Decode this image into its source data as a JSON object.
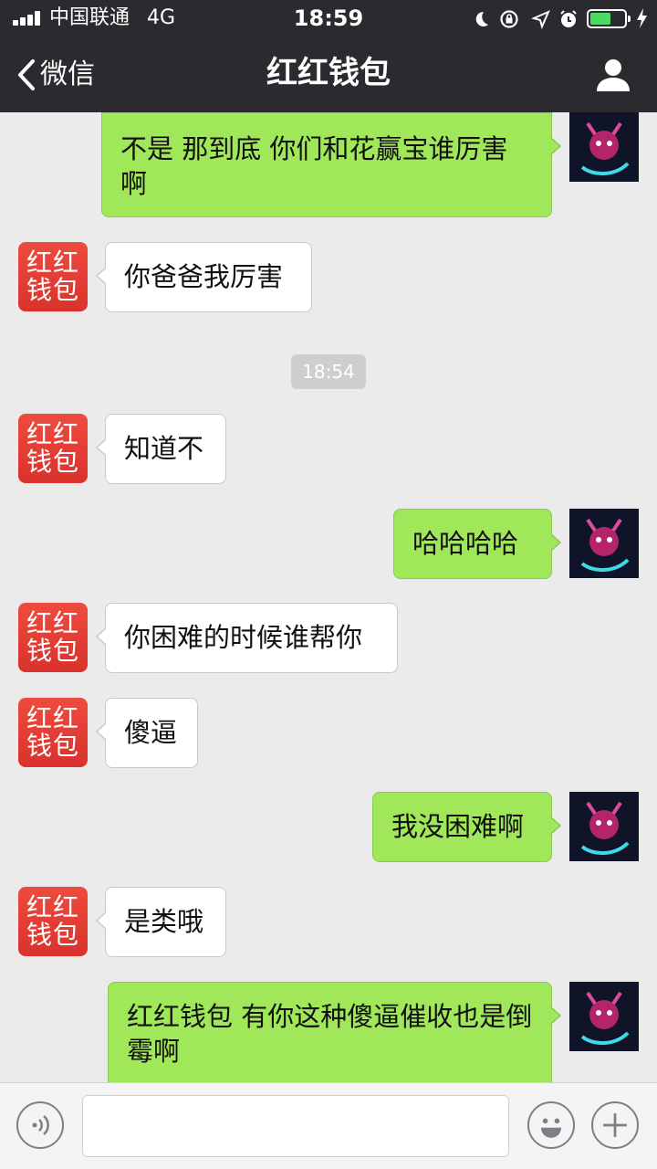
{
  "status_bar": {
    "carrier": "中国联通",
    "network": "4G",
    "time": "18:59",
    "icons": [
      "signal-icon",
      "moon-icon",
      "rotation-lock-icon",
      "location-arrow-icon",
      "alarm-icon",
      "battery-icon",
      "charging-bolt-icon"
    ],
    "battery_color": "#4cd964"
  },
  "nav": {
    "back_label": "微信",
    "title": "红红钱包",
    "right_icon": "person-icon"
  },
  "contact_avatar_text": "红红钱包",
  "colors": {
    "header_bg": "#2b2b2f",
    "chat_bg": "#ebebeb",
    "outgoing_bubble": "#a0e75a",
    "incoming_bubble": "#ffffff",
    "avatar_red": "#e1392f"
  },
  "messages": [
    {
      "side": "out",
      "text": "不是 那到底 你们和花赢宝谁厉害啊"
    },
    {
      "side": "in",
      "text": "你爸爸我厉害"
    },
    {
      "type": "time",
      "text": "18:54"
    },
    {
      "side": "in",
      "text": "知道不"
    },
    {
      "side": "out",
      "text": "哈哈哈哈"
    },
    {
      "side": "in",
      "text": "你困难的时候谁帮你"
    },
    {
      "side": "in",
      "text": "傻逼"
    },
    {
      "side": "out",
      "text": "我没困难啊"
    },
    {
      "side": "in",
      "text": "是类哦"
    },
    {
      "side": "out",
      "text": "红红钱包 有你这种傻逼催收也是倒霉啊"
    }
  ],
  "input_bar": {
    "left_icon": "voice-icon",
    "input_value": "",
    "emoji_icon": "emoji-icon",
    "plus_icon": "plus-icon"
  }
}
